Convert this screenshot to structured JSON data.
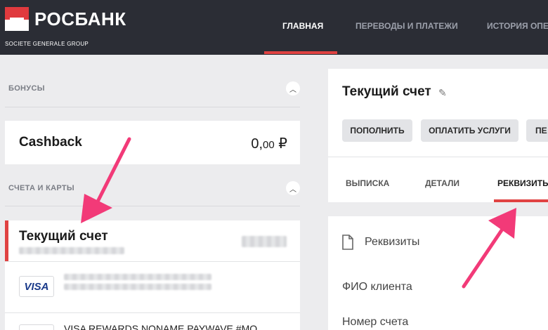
{
  "header": {
    "logo_text": "РОСБАНК",
    "logo_subtitle": "SOCIETE GENERALE GROUP",
    "nav": [
      {
        "label": "ГЛАВНАЯ",
        "active": true
      },
      {
        "label": "ПЕРЕВОДЫ И ПЛАТЕЖИ",
        "active": false
      },
      {
        "label": "ИСТОРИЯ ОПЕР",
        "active": false
      }
    ]
  },
  "left": {
    "bonuses_label": "БОНУСЫ",
    "cashback": {
      "title": "Cashback",
      "value_main": "0,",
      "value_cents": "00",
      "currency": "₽"
    },
    "accounts_label": "СЧЕТА И КАРТЫ",
    "account": {
      "title": "Текущий счет"
    },
    "cards": [
      {
        "brand": "VISA",
        "text": ""
      },
      {
        "brand": "",
        "text": "VISA REWARDS NONAME PAYWAVE #MO"
      }
    ]
  },
  "right": {
    "account_title": "Текущий счет",
    "buttons": [
      "ПОПОЛНИТЬ",
      "ОПЛАТИТЬ УСЛУГИ",
      "ПЕ"
    ],
    "tabs": [
      {
        "label": "ВЫПИСКА",
        "active": false
      },
      {
        "label": "ДЕТАЛИ",
        "active": false
      },
      {
        "label": "РЕКВИЗИТЫ",
        "active": true
      }
    ],
    "details": {
      "title": "Реквизиты",
      "fields": [
        "ФИО клиента",
        "Номер счета"
      ]
    }
  },
  "colors": {
    "header_bg": "#2b2d35",
    "accent_red": "#e04242",
    "arrow_pink": "#f23a78",
    "page_bg": "#ececee"
  }
}
